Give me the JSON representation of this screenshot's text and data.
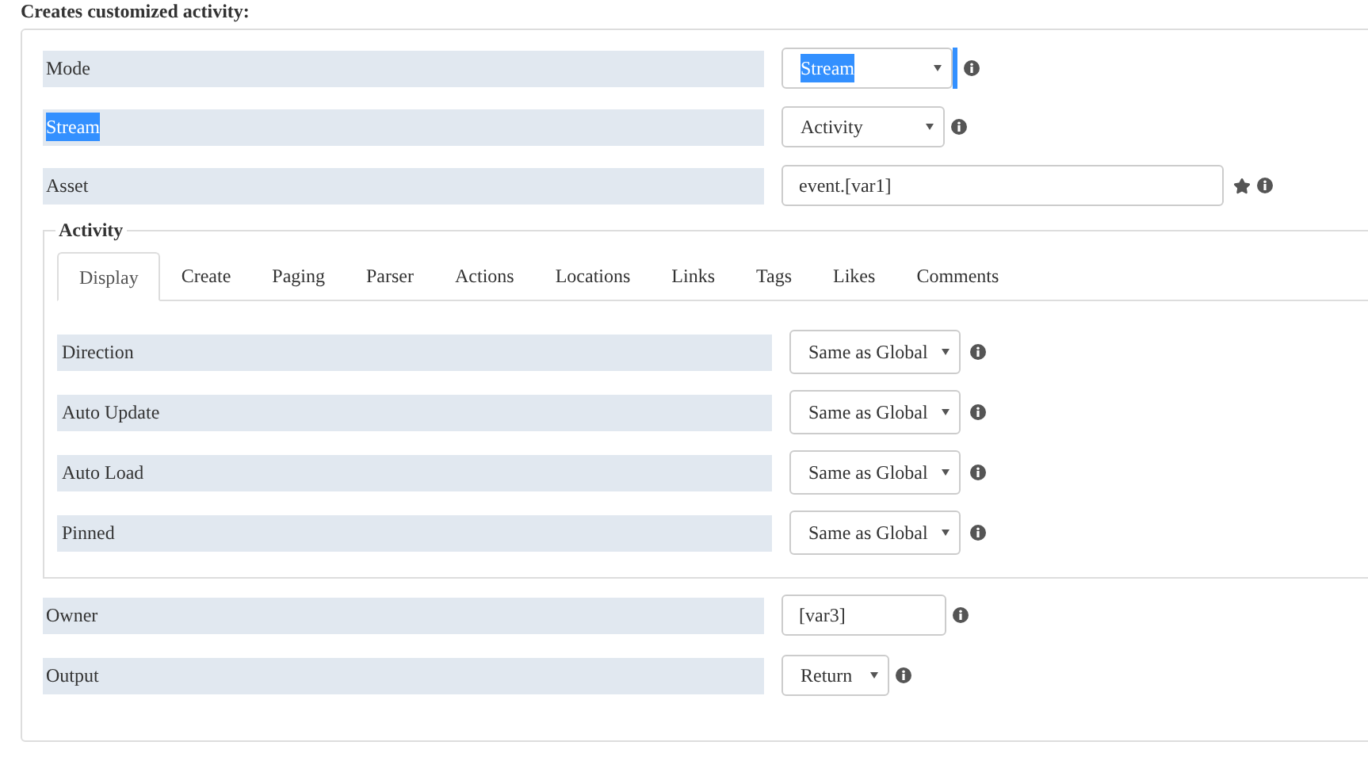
{
  "intro": "Creates customized activity:",
  "fields": [
    {
      "label": "Mode",
      "label_highlighted": false,
      "kind": "select",
      "value": "Stream",
      "value_highlighted": true,
      "focused": true,
      "starred": false
    },
    {
      "label": "Stream",
      "label_highlighted": true,
      "kind": "select",
      "value": "Activity",
      "value_highlighted": false,
      "focused": false,
      "starred": false
    },
    {
      "label": "Asset",
      "label_highlighted": false,
      "kind": "input",
      "value": "event.[var1]",
      "value_highlighted": false,
      "focused": false,
      "starred": true
    }
  ],
  "activity": {
    "legend": "Activity",
    "tabs": [
      {
        "label": "Display",
        "selected": true
      },
      {
        "label": "Create",
        "selected": false
      },
      {
        "label": "Paging",
        "selected": false
      },
      {
        "label": "Parser",
        "selected": false
      },
      {
        "label": "Actions",
        "selected": false
      },
      {
        "label": "Locations",
        "selected": false
      },
      {
        "label": "Links",
        "selected": false
      },
      {
        "label": "Tags",
        "selected": false
      },
      {
        "label": "Likes",
        "selected": false
      },
      {
        "label": "Comments",
        "selected": false
      }
    ],
    "fields": [
      {
        "label": "Direction",
        "kind": "select",
        "value": "Same as Global"
      },
      {
        "label": "Auto Update",
        "kind": "select",
        "value": "Same as Global"
      },
      {
        "label": "Auto Load",
        "kind": "select",
        "value": "Same as Global"
      },
      {
        "label": "Pinned",
        "kind": "select",
        "value": "Same as Global"
      }
    ]
  },
  "bottom_fields": [
    {
      "label": "Owner",
      "label_highlighted": false,
      "kind": "input",
      "value": "[var3]",
      "value_highlighted": false,
      "focused": false,
      "starred": false
    },
    {
      "label": "Output",
      "label_highlighted": false,
      "kind": "select",
      "value": "Return",
      "value_highlighted": false,
      "focused": false,
      "starred": false
    }
  ]
}
